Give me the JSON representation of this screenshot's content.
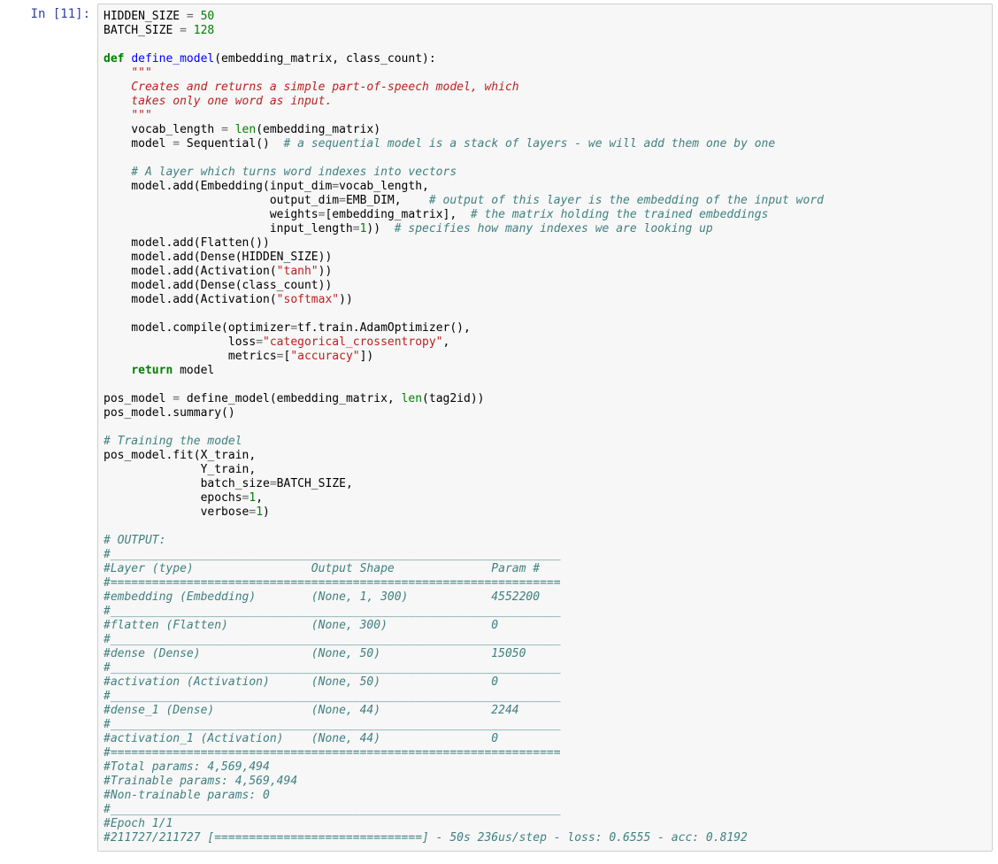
{
  "prompt": {
    "label": "In [11]:"
  },
  "code": {
    "const_hidden": "HIDDEN_SIZE",
    "const_batch": "BATCH_SIZE",
    "val_hidden": "50",
    "val_batch": "128",
    "def": "def",
    "fn_name": "define_model",
    "fn_params": "(embedding_matrix, class_count):",
    "doc_q": "\"\"\"",
    "doc_l1": "    Creates and returns a simple part-of-speech model, which",
    "doc_l2": "    takes only one word as input.",
    "vocab_line_a": "    vocab_length ",
    "len_fn": "len",
    "vocab_line_b": "(embedding_matrix)",
    "model_assign": "    model ",
    "seq": " Sequential()  ",
    "seq_c": "# a sequential model is a stack of layers - we will add them one by one",
    "c_emb_layer": "    # A layer which turns word indexes into vectors",
    "emb_l1a": "    model.add(Embedding(input_dim",
    "emb_l1b": "vocab_length,",
    "emb_l2a": "                        output_dim",
    "emb_l2b": "EMB_DIM,    ",
    "emb_l2c": "# output of this layer is the embedding of the input word",
    "emb_l3a": "                        weights",
    "emb_l3b": "[embedding_matrix],  ",
    "emb_l3c": "# the matrix holding the trained embeddings",
    "emb_l4a": "                        input_length",
    "emb_l4b": "))  ",
    "emb_l4c": "# specifies how many indexes we are looking up",
    "one": "1",
    "flatten": "    model.add(Flatten())",
    "dense_hidden": "    model.add(Dense(HIDDEN_SIZE))",
    "act_tanh_a": "    model.add(Activation(",
    "act_tanh_s": "\"tanh\"",
    "act_close": "))",
    "dense_cls": "    model.add(Dense(class_count))",
    "act_soft_a": "    model.add(Activation(",
    "act_soft_s": "\"softmax\"",
    "compile_a": "    model.compile(optimizer",
    "compile_b": "tf.train.AdamOptimizer(),",
    "compile_loss_a": "                  loss",
    "compile_loss_s": "\"categorical_crossentropy\"",
    "compile_met_a": "                  metrics",
    "compile_met_b": "[",
    "compile_met_s": "\"accuracy\"",
    "compile_met_c": "])",
    "ret": "return",
    "ret_b": " model",
    "pos_a": "pos_model ",
    "pos_b": " define_model(embedding_matrix, ",
    "pos_c": "(tag2id))",
    "summary": "pos_model.summary()",
    "c_train": "# Training the model",
    "fit_l1": "pos_model.fit(X_train,",
    "fit_l2": "              Y_train,",
    "fit_l3a": "              batch_size",
    "fit_l3b": "BATCH_SIZE,",
    "fit_l4a": "              epochs",
    "fit_l4b": ",",
    "fit_l5a": "              verbose",
    "fit_l5b": ")",
    "out_header": "# OUTPUT:",
    "sep_us": "#_________________________________________________________________",
    "row_head": "#Layer (type)                 Output Shape              Param #   ",
    "sep_eq": "#=================================================================",
    "row_emb": "#embedding (Embedding)        (None, 1, 300)            4552200   ",
    "row_flt": "#flatten (Flatten)            (None, 300)               0         ",
    "row_d0": "#dense (Dense)                (None, 50)                15050     ",
    "row_a0": "#activation (Activation)      (None, 50)                0         ",
    "row_d1": "#dense_1 (Dense)              (None, 44)                2244      ",
    "row_a1": "#activation_1 (Activation)    (None, 44)                0         ",
    "tot": "#Total params: 4,569,494",
    "train": "#Trainable params: 4,569,494",
    "nontrain": "#Non-trainable params: 0",
    "epoch": "#Epoch 1/1",
    "prog": "#211727/211727 [==============================] - 50s 236us/step - loss: 0.6555 - acc: 0.8192"
  }
}
